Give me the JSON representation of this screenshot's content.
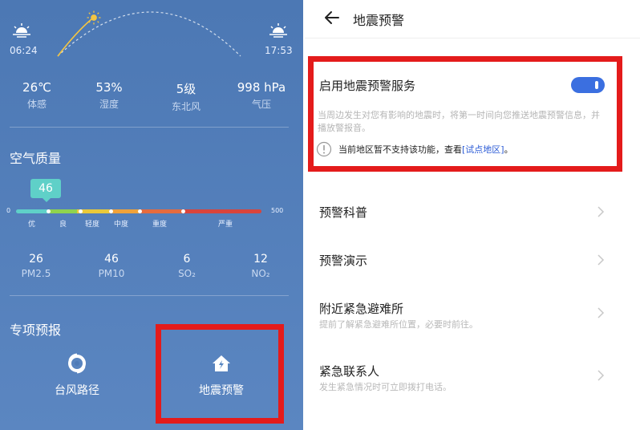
{
  "weather": {
    "sunrise": "06:24",
    "sunset": "17:53",
    "stats": [
      {
        "value": "26℃",
        "label": "体感"
      },
      {
        "value": "53%",
        "label": "湿度"
      },
      {
        "value": "5级",
        "label": "东北风"
      },
      {
        "value": "998 hPa",
        "label": "气压"
      }
    ]
  },
  "air_quality": {
    "title": "空气质量",
    "aqi": "46",
    "scale_min": "0",
    "scale_max": "500",
    "levels": [
      "优",
      "良",
      "轻度",
      "中度",
      "重度",
      "严重"
    ],
    "colors": [
      "#5fd0c8",
      "#8fd34e",
      "#e9c93a",
      "#f0a23a",
      "#e56b3e",
      "#d9443b"
    ],
    "pollutants": [
      {
        "value": "26",
        "label": "PM2.5"
      },
      {
        "value": "46",
        "label": "PM10"
      },
      {
        "value": "6",
        "label": "SO₂"
      },
      {
        "value": "12",
        "label": "NO₂"
      }
    ]
  },
  "special_forecast": {
    "title": "专项预报",
    "items": [
      {
        "label": "台风路径",
        "icon": "typhoon-icon"
      },
      {
        "label": "地震预警",
        "icon": "house-alert-icon"
      }
    ]
  },
  "earthquake_page": {
    "title": "地震预警",
    "toggle_title": "启用地震预警服务",
    "toggle_on": true,
    "description": "当周边发生对您有影响的地震时，将第一时间向您推送地震预警信息，并播放警报音。",
    "notice_text": "当前地区暂不支持该功能，查看",
    "notice_link": "[试点地区]",
    "notice_end": "。",
    "menu": [
      {
        "title": "预警科普",
        "subtitle": ""
      },
      {
        "title": "预警演示",
        "subtitle": ""
      },
      {
        "title": "附近紧急避难所",
        "subtitle": "提前了解紧急避难所位置，必要时前往。"
      },
      {
        "title": "紧急联系人",
        "subtitle": "发生紧急情况时可立即拨打电话。"
      }
    ]
  },
  "accent_color": "#3b6fe0",
  "highlight_color": "#e41b1b"
}
